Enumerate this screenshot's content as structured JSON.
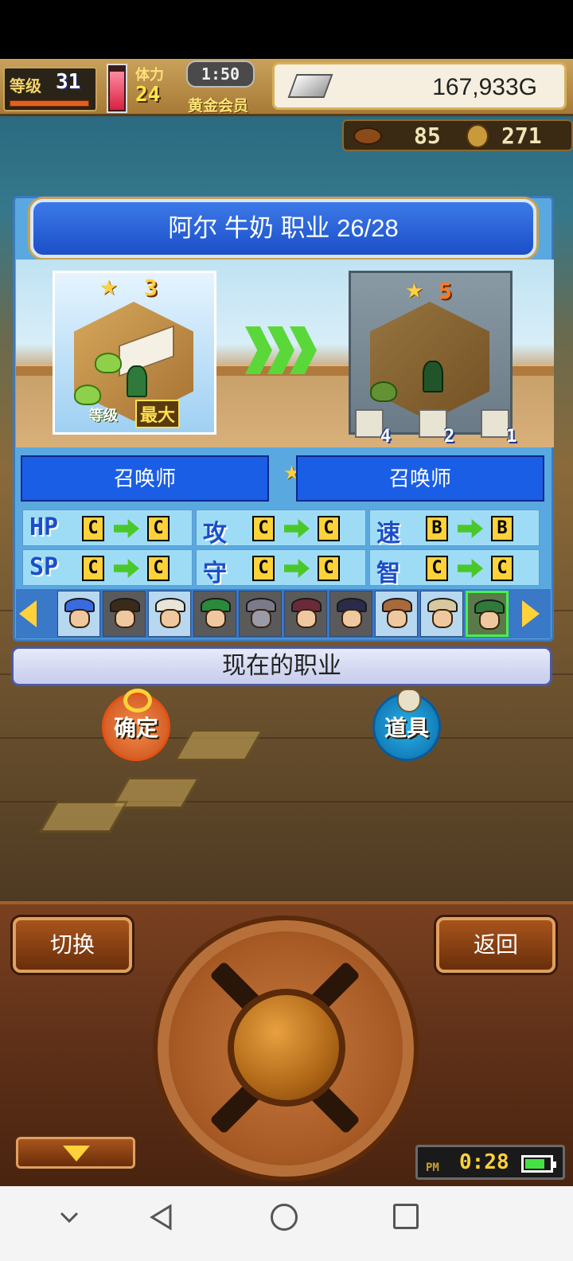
{
  "hud": {
    "level_label": "等级",
    "level_value": "31",
    "stamina_label": "体力",
    "stamina_value": "24",
    "timer": "1:50",
    "membership": "黄金会员",
    "gold": "167,933G",
    "resource1_value": "85",
    "resource2_value": "271"
  },
  "dialog": {
    "title": "阿尔 牛奶  职业 26/28",
    "current": {
      "star_rank": "3",
      "level_label": "等级",
      "level_state": "最大",
      "job_name": "召唤师"
    },
    "next": {
      "star_rank": "5",
      "job_name": "召唤师",
      "badges": [
        {
          "icon": "anchor-icon",
          "count": "4"
        },
        {
          "icon": "sword-icon",
          "count": "2"
        },
        {
          "icon": "fist-icon",
          "count": "1"
        }
      ]
    },
    "stats": [
      {
        "label": "HP",
        "from": "C",
        "to": "C"
      },
      {
        "label": "攻",
        "from": "C",
        "to": "C"
      },
      {
        "label": "速",
        "from": "B",
        "to": "B"
      },
      {
        "label": "SP",
        "from": "C",
        "to": "C"
      },
      {
        "label": "守",
        "from": "C",
        "to": "C"
      },
      {
        "label": "智",
        "from": "C",
        "to": "C"
      }
    ],
    "current_job_button": "现在的职业"
  },
  "actions": {
    "confirm": "确定",
    "items": "道具"
  },
  "panel": {
    "switch_label": "切换",
    "back_label": "返回",
    "clock_period": "PM",
    "clock_time": "0:28"
  },
  "colors": {
    "accent_blue": "#1a5ee6",
    "grade_yellow": "#ffd23a",
    "arrow_green": "#4ac82a"
  }
}
